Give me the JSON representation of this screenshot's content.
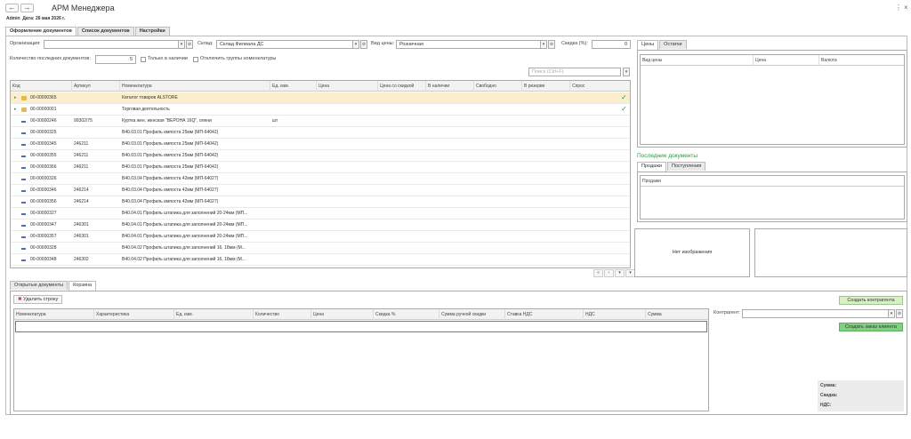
{
  "window": {
    "title": "АРМ Менеджера",
    "user": "Admin",
    "date_line": "Дата: 26 мая 2026 г.",
    "back_glyph": "←",
    "forward_glyph": "→",
    "menu_glyph": "⋮",
    "close_glyph": "×"
  },
  "main_tabs": [
    "Оформление документов",
    "Список документов",
    "Настройки"
  ],
  "form": {
    "org_label": "Организация:",
    "org_value": "",
    "warehouse_label": "Склад:",
    "warehouse_value": "Склад Филиала ДС",
    "price_type_label": "Вид цены:",
    "price_type_value": "Розничная",
    "discount_label": "Скидка (%):",
    "discount_value": "0",
    "last_docs_label": "Количество последних документов:",
    "last_docs_value": "5",
    "only_in_stock_label": "Только в наличии",
    "disable_groups_label": "Отключить группы номенклатуры",
    "search_placeholder": "Поиск (Ctrl+F)"
  },
  "catalog": {
    "columns": [
      "Код",
      "Артикул",
      "Номенклатура",
      "Ед. изм.",
      "Цена",
      "Цена со скидкой",
      "В наличии",
      "Свободно",
      "В резерве",
      "Спрос"
    ],
    "rows": [
      {
        "kind": "folder",
        "code": "00-00000365",
        "article": "",
        "name": "Каталог товаров ALSTORE",
        "unit": "",
        "check": "✓",
        "selected": true
      },
      {
        "kind": "folder",
        "code": "00-00000001",
        "article": "",
        "name": "Торговая деятельность",
        "unit": "",
        "check": "✓",
        "selected": false
      },
      {
        "kind": "item",
        "code": "00-00000246",
        "article": "99302/75",
        "name": "Куртка жен. женская \"ВЕРОНА 16Q\", олени",
        "unit": "шт",
        "check": "",
        "selected": false
      },
      {
        "kind": "item",
        "code": "00-00000325",
        "article": "",
        "name": "В40.03.01 Профиль импоста 25мм (МП-64042)",
        "unit": "",
        "check": "",
        "selected": false
      },
      {
        "kind": "item",
        "code": "00-00000345",
        "article": "246211",
        "name": "В40.03.01 Профиль импоста 25мм (МП-64042)",
        "unit": "",
        "check": "",
        "selected": false
      },
      {
        "kind": "item",
        "code": "00-00000355",
        "article": "246211",
        "name": "В40.03.01 Профиль импоста 25мм (МП-64042)",
        "unit": "",
        "check": "",
        "selected": false
      },
      {
        "kind": "item",
        "code": "00-00000366",
        "article": "246211",
        "name": "В40.03.01 Профиль импоста 25мм (МП-64042)",
        "unit": "",
        "check": "",
        "selected": false
      },
      {
        "kind": "item",
        "code": "00-00000326",
        "article": "",
        "name": "В40.03.04 Профиль импоста 42мм (МП-64027)",
        "unit": "",
        "check": "",
        "selected": false
      },
      {
        "kind": "item",
        "code": "00-00000346",
        "article": "246214",
        "name": "В40.03.04 Профиль импоста 42мм (МП-64027)",
        "unit": "",
        "check": "",
        "selected": false
      },
      {
        "kind": "item",
        "code": "00-00000356",
        "article": "246214",
        "name": "В40.03.04 Профиль импоста 42мм (МП-64027)",
        "unit": "",
        "check": "",
        "selected": false
      },
      {
        "kind": "item",
        "code": "00-00000327",
        "article": "",
        "name": "В40.04.01 Профиль штапика для заполнений 20-24мм (МП...",
        "unit": "",
        "check": "",
        "selected": false
      },
      {
        "kind": "item",
        "code": "00-00000347",
        "article": "246301",
        "name": "В40.04.01 Профиль штапика для заполнений 20-24мм (МП...",
        "unit": "",
        "check": "",
        "selected": false
      },
      {
        "kind": "item",
        "code": "00-00000357",
        "article": "246301",
        "name": "В40.04.01 Профиль штапика для заполнений 20-24мм (МП...",
        "unit": "",
        "check": "",
        "selected": false
      },
      {
        "kind": "item",
        "code": "00-00000328",
        "article": "",
        "name": "В40.04.02 Профиль штапика для заполнений 16, 18мм (М...",
        "unit": "",
        "check": "",
        "selected": false
      },
      {
        "kind": "item",
        "code": "00-00000348",
        "article": "246302",
        "name": "В40.04.02 Профиль штапика для заполнений 16, 18мм (М...",
        "unit": "",
        "check": "",
        "selected": false
      },
      {
        "kind": "item",
        "code": "00-00000358",
        "article": "246302",
        "name": "В40.04.02 Профиль штапика для заполнений 16, 18мм (М...",
        "unit": "",
        "check": "",
        "selected": false
      }
    ],
    "nav": [
      "«",
      "‹",
      "▾",
      "▾"
    ]
  },
  "prices_panel": {
    "tabs": [
      "Цены",
      "Остатки"
    ],
    "columns": [
      "Вид цены",
      "Цена",
      "Валюта"
    ]
  },
  "last_docs": {
    "title": "Последние документы",
    "tabs": [
      "Продажи",
      "Поступления"
    ],
    "column": "Продажи"
  },
  "image_panel": {
    "no_image": "Нет изображения"
  },
  "bottom_tabs": [
    "Открытые документы",
    "Корзина"
  ],
  "cart": {
    "delete_row": "Удалить строку",
    "columns": [
      "Номенклатура",
      "Характеристика",
      "Ед. изм.",
      "Количество",
      "Цена",
      "Скидка %",
      "Сумма ручной скидки",
      "Ставка НДС",
      "НДС",
      "Сумма"
    ]
  },
  "right_bottom": {
    "create_counterparty": "Создать контрагента",
    "counterparty_label": "Контрагент:",
    "counterparty_value": "",
    "create_order": "Создать заказ клиента",
    "sum_label": "Сумма:",
    "discount_label": "Скидка:",
    "vat_label": "НДС:"
  },
  "colors": {
    "accent_green": "#2a9a3a",
    "selected_row": "#fbeecc",
    "green_button": "#7fd17f"
  }
}
